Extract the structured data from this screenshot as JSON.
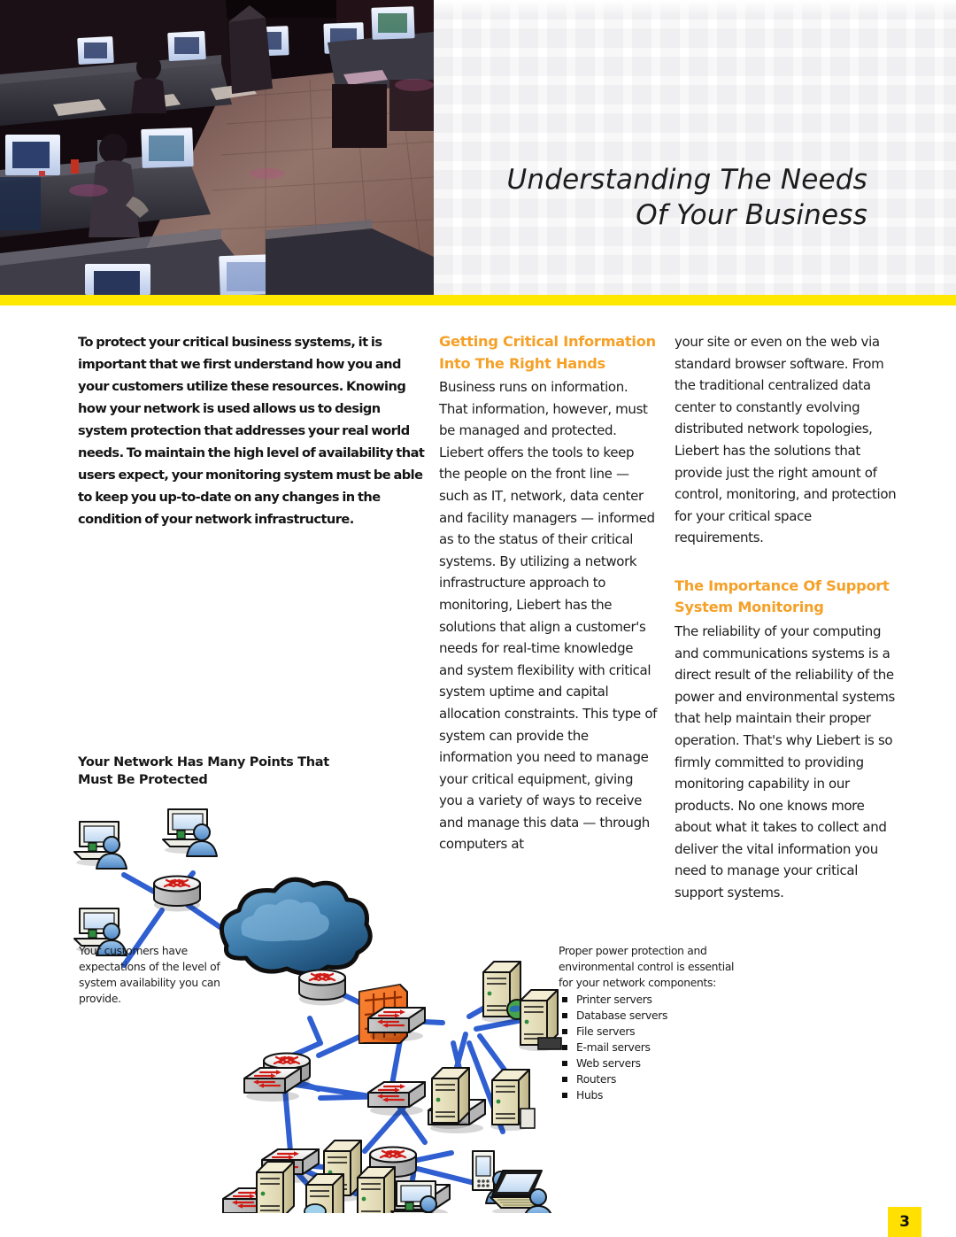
{
  "header": {
    "title_line1": "Understanding The Needs",
    "title_line2": "Of Your Business",
    "photo_alt": "network-operations-center-photo",
    "accent_yellow": "#ffe800"
  },
  "lead_paragraph": "To protect your critical business systems, it is important that we first understand how you and your customers utilize these resources. Knowing how your network is used allows us to design system protection that addresses your real world needs. To maintain the high level of availability that users expect, your monitoring system must be able to keep you up-to-date on any changes in the condition of your network infrastructure.",
  "sections": [
    {
      "heading_line1": "Getting Critical Information",
      "heading_line2": "Into The Right Hands",
      "heading_color": "#f5a027",
      "body": "Business runs on information. That information, however, must be managed and protected. Liebert offers the tools to keep the people on the front line — such as IT, network, data center and facility managers — informed as to the status of their critical systems. By utilizing a network infrastructure approach to monitoring, Liebert has the solutions that align a customer's needs for real-time knowledge and system flexibility with critical system uptime and capital allocation constraints. This type of system can provide the information you need to manage your critical equipment, giving you a variety of ways to receive and manage this data — through computers at",
      "body_continued": "your site or even on the web via standard browser software. From the traditional centralized data center to constantly evolving distributed network topologies, Liebert has the solutions that provide just the right amount of control, monitoring, and protection for your critical space requirements."
    },
    {
      "heading_line1": "The Importance Of Support",
      "heading_line2": "System Monitoring",
      "heading_color": "#f5a027",
      "body": "The reliability of your computing and communications systems is a direct result of the reliability of the power and environmental systems that help maintain their proper operation. That's why Liebert is so firmly committed to providing monitoring capability in our products. No one knows more about what it takes to collect and deliver the vital information you need to manage your critical support systems."
    }
  ],
  "diagram": {
    "heading_line1": "Your Network Has Many Points That",
    "heading_line2": "Must Be Protected",
    "caption_left": "Your customers have expectations of the level of system availability you can provide.",
    "caption_right_intro": "Proper power protection and environmental control is essential for your network components:",
    "caption_right_items": [
      "Printer servers",
      "Database servers",
      "File servers",
      "E-mail servers",
      "Web servers",
      "Routers",
      "Hubs"
    ],
    "link_color": "#2f5fd0",
    "firewall_color": "#f0691f",
    "cloud_color": "#3e78b2"
  },
  "footer": {
    "page_number": "3",
    "badge_color": "#ffe000"
  }
}
